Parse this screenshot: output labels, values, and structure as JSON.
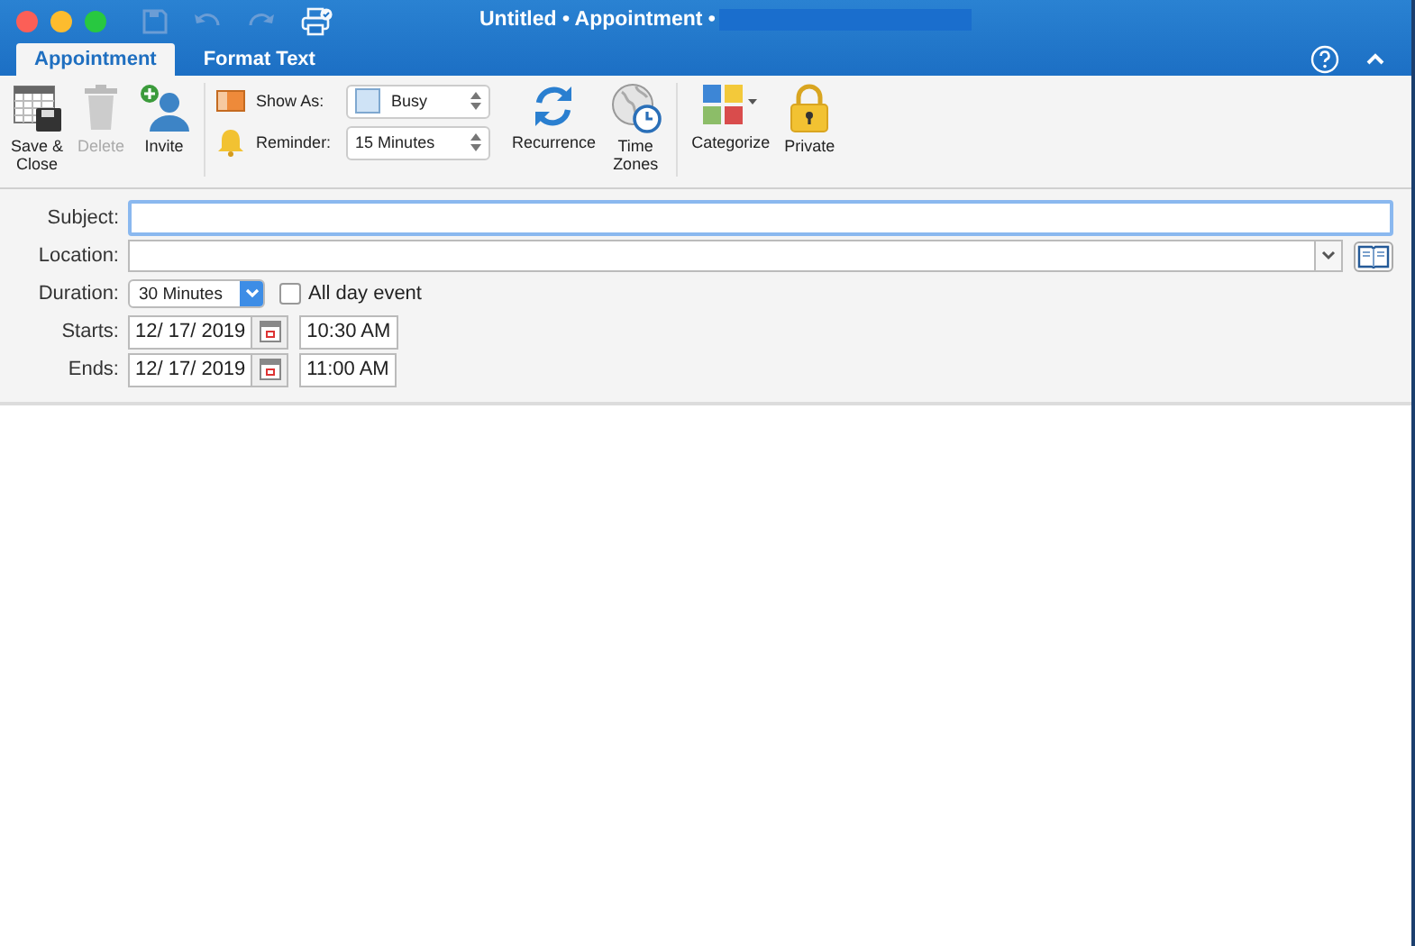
{
  "window": {
    "title": "Untitled • Appointment •"
  },
  "tabs": [
    {
      "label": "Appointment",
      "selected": true
    },
    {
      "label": "Format Text",
      "selected": false
    }
  ],
  "ribbon": {
    "actions": [
      {
        "kind": "save",
        "label": "Save &\nClose",
        "disabled": false
      },
      {
        "kind": "delete",
        "label": "Delete",
        "disabled": true
      },
      {
        "kind": "invite",
        "label": "Invite",
        "disabled": false
      }
    ],
    "show_as": {
      "label": "Show As:",
      "value": "Busy"
    },
    "reminder": {
      "label": "Reminder:",
      "value": "15 Minutes"
    },
    "options": [
      {
        "kind": "recurrence",
        "label": "Recurrence"
      },
      {
        "kind": "timezones",
        "label": "Time\nZones"
      }
    ],
    "tags": [
      {
        "kind": "categorize",
        "label": "Categorize"
      },
      {
        "kind": "private",
        "label": "Private"
      }
    ]
  },
  "form": {
    "subject": {
      "label": "Subject:"
    },
    "location": {
      "label": "Location:"
    },
    "duration": {
      "label": "Duration:",
      "value": "30 Minutes"
    },
    "all_day": {
      "label": "All day event",
      "checked": false
    },
    "starts": {
      "label": "Starts:",
      "date": "12/ 17/ 2019",
      "time": "10:30 AM"
    },
    "ends": {
      "label": "Ends:",
      "date": "12/ 17/ 2019",
      "time": "11:00 AM"
    }
  }
}
